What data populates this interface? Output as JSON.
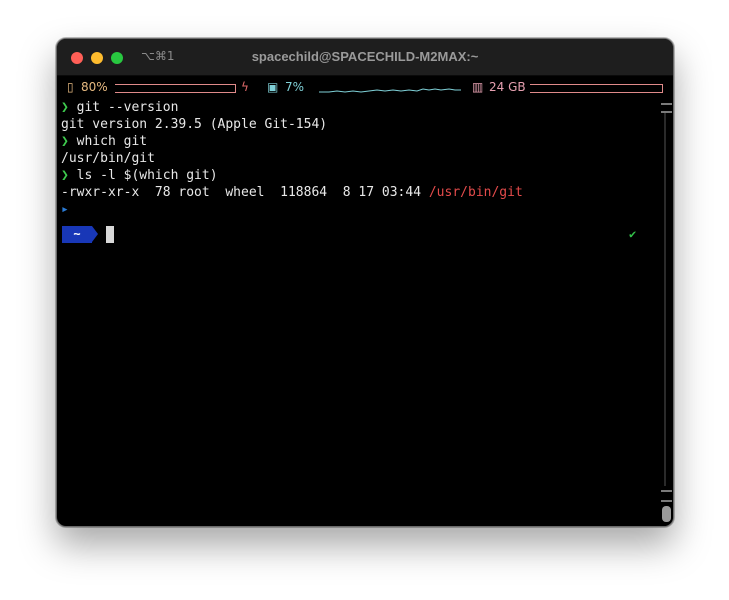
{
  "window": {
    "title": "spacechild@SPACECHILD-M2MAX:~",
    "shortcut": "⌥⌘1"
  },
  "statusbar": {
    "battery_icon": "battery-icon",
    "battery": "80%",
    "charging_icon": "bolt-icon",
    "cpu_icon": "cpu-chip-icon",
    "cpu": "7%",
    "memory_icon": "memory-icon",
    "memory": "24 GB"
  },
  "terminal": {
    "prompt_symbol": "❯",
    "lines": [
      {
        "prompt": "❯",
        "text": " git --version"
      },
      {
        "text": "git version 2.39.5 (Apple Git-154)"
      },
      {
        "prompt": "❯",
        "text": " which git"
      },
      {
        "text": "/usr/bin/git"
      },
      {
        "prompt": "❯",
        "text": " ls -l $(which git)"
      },
      {
        "text": "-rwxr-xr-x  78 root  wheel  118864  8 17 03:44 ",
        "highlight": "/usr/bin/git"
      }
    ],
    "cwd": "~",
    "status_check": "✔"
  },
  "colors": {
    "prompt": "#3ecb4e",
    "path_highlight": "#e44b4b",
    "cwd_segment": "#1837b7",
    "cpu": "#7fd1d8",
    "battery": "#e6b980",
    "memory": "#e6a0b0"
  }
}
